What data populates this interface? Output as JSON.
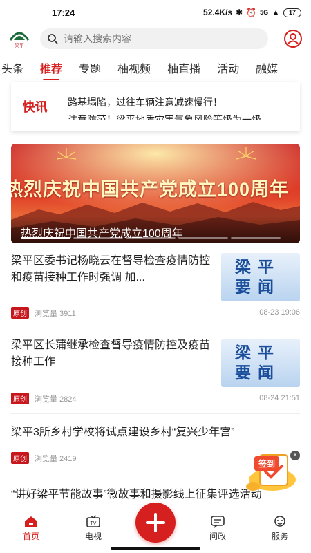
{
  "status_bar": {
    "time": "17:24",
    "speed": "52.4K/s",
    "signal_label": "5G",
    "battery": "17"
  },
  "header": {
    "logo_text": "梁平",
    "search": {
      "placeholder": "请输入搜索内容"
    }
  },
  "tabs": [
    {
      "label": "头条",
      "active": false
    },
    {
      "label": "推荐",
      "active": true
    },
    {
      "label": "专题",
      "active": false
    },
    {
      "label": "柚视频",
      "active": false
    },
    {
      "label": "柚直播",
      "active": false
    },
    {
      "label": "活动",
      "active": false
    },
    {
      "label": "融媒",
      "active": false
    }
  ],
  "flash": {
    "label": "快讯",
    "lines": [
      "路基塌陷，过往车辆注意减速慢行！",
      "注意防范！梁平地质灾害气象风险等级为一级"
    ]
  },
  "banner": {
    "headline": "热烈庆祝中国共产党成立100周年",
    "caption": "热烈庆祝中国共产党成立100周年"
  },
  "news": [
    {
      "title": "梁平区委书记杨晓云在督导检查疫情防控和疫苗接种工作时强调 加...",
      "badge": "原创",
      "views": "浏览量 3911",
      "date": "08-23 19:06",
      "thumb": "梁平要闻"
    },
    {
      "title": "梁平区长蒲继承检查督导疫情防控及疫苗接种工作",
      "badge": "原创",
      "views": "浏览量 2824",
      "date": "08-24 21:51",
      "thumb": "梁平要闻"
    },
    {
      "title": "梁平3所乡村学校将试点建设乡村“复兴少年宫”",
      "badge": "原创",
      "views": "浏览量 2419",
      "date": "",
      "thumb": ""
    },
    {
      "title": "“讲好梁平节能故事”微故事和摄影线上征集评选活动",
      "badge": "",
      "views": "",
      "date": "",
      "thumb": ""
    }
  ],
  "signin": {
    "label": "签到",
    "close": "×"
  },
  "bottom_nav": [
    {
      "label": "首页",
      "icon": "home-icon",
      "active": true
    },
    {
      "label": "电视",
      "icon": "tv-icon",
      "active": false
    },
    {
      "label": "",
      "icon": "plus-icon",
      "active": false
    },
    {
      "label": "问政",
      "icon": "message-icon",
      "active": false
    },
    {
      "label": "服务",
      "icon": "service-icon",
      "active": false
    }
  ],
  "colors": {
    "accent": "#d6201f",
    "brand_green": "#1d6b3a"
  }
}
